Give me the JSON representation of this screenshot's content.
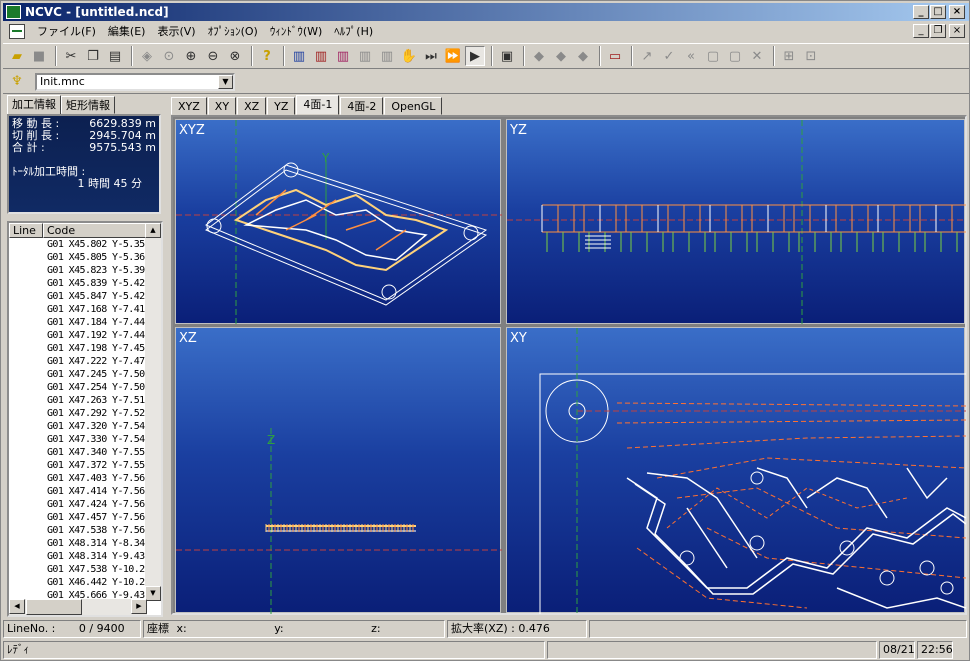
{
  "window": {
    "title": "NCVC - [untitled.ncd]",
    "buttons": {
      "minimize": "_",
      "maximize": "□",
      "close": "×",
      "restore": "❐"
    }
  },
  "menu": {
    "items": [
      "ファイル(F)",
      "編集(E)",
      "表示(V)",
      "ｵﾌﾟｼｮﾝ(O)",
      "ｳｨﾝﾄﾞｳ(W)",
      "ﾍﾙﾌﾟ(H)"
    ]
  },
  "toolbar2": {
    "combo_value": "Init.mnc",
    "combo_arrow": "▼"
  },
  "left_tabs": [
    "加工情報",
    "矩形情報"
  ],
  "info": {
    "move_label": "移 動 長 :",
    "move_value": "6629.839",
    "move_unit": "m",
    "cut_label": "切 削 長 :",
    "cut_value": "2945.704",
    "cut_unit": "m",
    "total_label": "合   計 :",
    "total_value": "9575.543",
    "total_unit": "m",
    "time_label": "ﾄｰﾀﾙ加工時間 :",
    "time_value": "1 時間 45 分"
  },
  "codelist": {
    "headers": [
      "Line",
      "Code"
    ],
    "scroll_up": "▲",
    "scroll_down": "▼",
    "scroll_left": "◀",
    "scroll_right": "▶",
    "rows": [
      "G01 X45.802 Y-5.35",
      "G01 X45.805 Y-5.36",
      "G01 X45.823 Y-5.39",
      "G01 X45.839 Y-5.42",
      "G01 X45.847 Y-5.42",
      "G01 X47.168 Y-7.41",
      "G01 X47.184 Y-7.44",
      "G01 X47.192 Y-7.44",
      "G01 X47.198 Y-7.45",
      "G01 X47.222 Y-7.47",
      "G01 X47.245 Y-7.50",
      "G01 X47.254 Y-7.50",
      "G01 X47.263 Y-7.51",
      "G01 X47.292 Y-7.52",
      "G01 X47.320 Y-7.54",
      "G01 X47.330 Y-7.54",
      "G01 X47.340 Y-7.55",
      "G01 X47.372 Y-7.55",
      "G01 X47.403 Y-7.56",
      "G01 X47.414 Y-7.56",
      "G01 X47.424 Y-7.56",
      "G01 X47.457 Y-7.56",
      "G01 X47.538 Y-7.56",
      "G01 X48.314 Y-8.34",
      "G01 X48.314 Y-9.43",
      "G01 X47.538 Y-10.2",
      "G01 X46.442 Y-10.2",
      "G01 X45.666 Y-9.43"
    ]
  },
  "view_tabs": [
    "XYZ",
    "XY",
    "XZ",
    "YZ",
    "4面-1",
    "4面-2",
    "OpenGL"
  ],
  "panes": {
    "xyz": {
      "label": "XYZ",
      "axis": "Y"
    },
    "yz": {
      "label": "YZ"
    },
    "xz": {
      "label": "XZ",
      "axis": "Z"
    },
    "xy": {
      "label": "XY"
    }
  },
  "status1": {
    "line_no": "LineNo. :",
    "line_value": "0 /   9400",
    "coord_label": "座標",
    "x": "x:",
    "y": "y:",
    "z": "z:",
    "zoom": "拡大率(XZ) : 0.476"
  },
  "status2": {
    "ready": "ﾚﾃﾞｨ",
    "date": "08/21",
    "time": "22:56"
  }
}
